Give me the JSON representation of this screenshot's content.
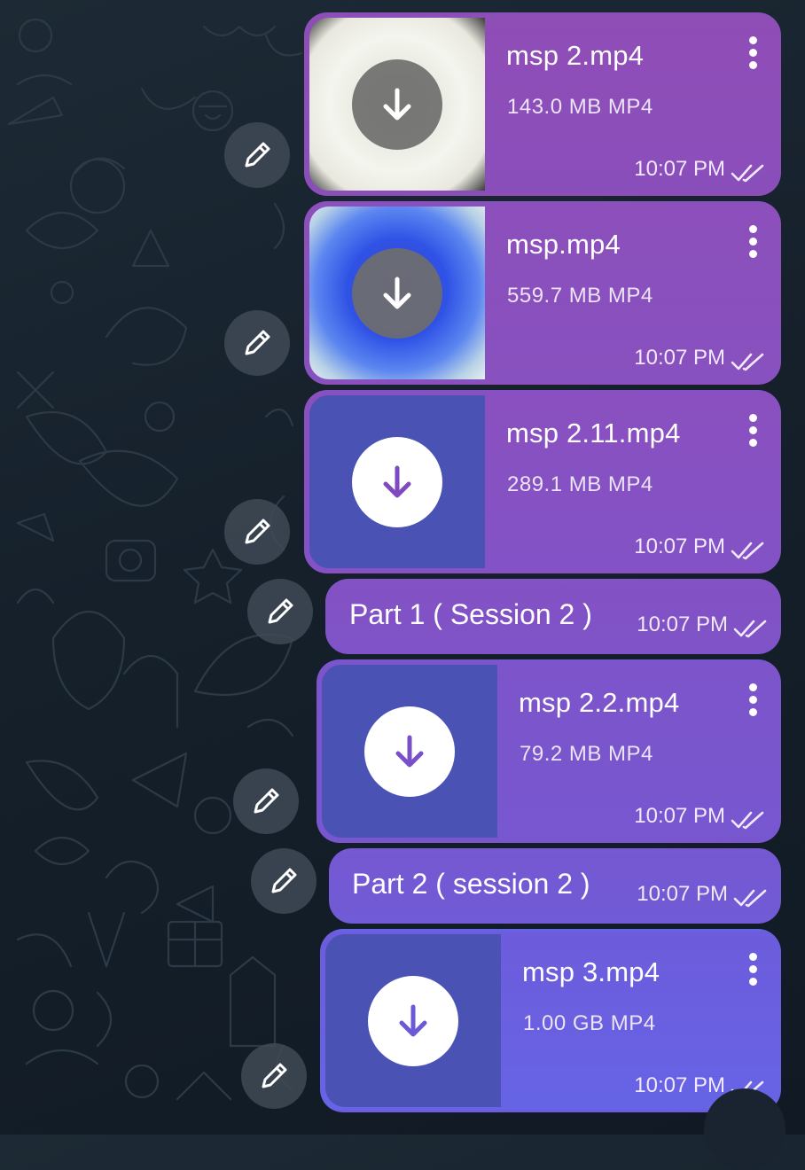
{
  "messages": [
    {
      "kind": "file",
      "filename": "msp 2.mp4",
      "size": "143.0 MB MP4",
      "time": "10:07 PM",
      "thumb": "white",
      "download": "grey"
    },
    {
      "kind": "file",
      "filename": "msp.mp4",
      "size": "559.7 MB MP4",
      "time": "10:07 PM",
      "thumb": "blue",
      "download": "grey"
    },
    {
      "kind": "file",
      "filename": "msp 2.11.mp4",
      "size": "289.1 MB MP4",
      "time": "10:07 PM",
      "thumb": "solid",
      "download": "white"
    },
    {
      "kind": "text",
      "text": "Part 1 ( Session 2 )",
      "time": "10:07 PM"
    },
    {
      "kind": "file",
      "filename": "msp 2.2.mp4",
      "size": "79.2 MB MP4",
      "time": "10:07 PM",
      "thumb": "solid",
      "download": "white"
    },
    {
      "kind": "text",
      "text": "Part 2 ( session 2 )",
      "time": "10:07 PM"
    },
    {
      "kind": "file",
      "filename": "msp 3.mp4",
      "size": "1.00 GB MP4",
      "time": "10:07 PM",
      "thumb": "solid",
      "download": "white"
    }
  ],
  "icons": {
    "download": "download-arrow-icon",
    "edit": "pencil-icon",
    "menu": "more-vertical-icon",
    "status": "double-check-icon"
  },
  "colors": {
    "bubble_top": "#8e4fb8",
    "bubble_bottom": "#6a62e6",
    "thumb_solid": "#4a52b4",
    "background": "#15202b"
  }
}
